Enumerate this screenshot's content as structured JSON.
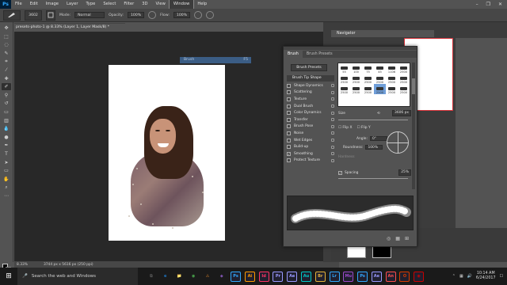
{
  "app": {
    "logo": "Ps",
    "menu": [
      "File",
      "Edit",
      "Image",
      "Layer",
      "Type",
      "Select",
      "Filter",
      "3D",
      "View",
      "Window",
      "Help"
    ],
    "active_menu": "Window",
    "window_controls": [
      "–",
      "❐",
      "✕"
    ]
  },
  "options_bar": {
    "brush_size": "3602",
    "mode_label": "Mode:",
    "mode_value": "Normal",
    "opacity_label": "Opacity:",
    "opacity_value": "100%",
    "flow_label": "Flow:",
    "flow_value": "100%"
  },
  "document": {
    "tab_title": "presets-photo-1 @ 8.33% (Layer 1, Layer Mask/8) *",
    "zoom": "8.33%",
    "doc_info": "3744 px x 5616 px (250 ppi)"
  },
  "brush_ghost": {
    "title": "Brush",
    "badge": "F5"
  },
  "navigator": {
    "title": "Navigator"
  },
  "brush_panel": {
    "tabs": [
      "Brush",
      "Brush Presets"
    ],
    "presets_button": "Brush Presets",
    "options_header": "Brush Tip Shape",
    "options": [
      {
        "label": "Shape Dynamics",
        "checked": false
      },
      {
        "label": "Scattering",
        "checked": false
      },
      {
        "label": "Texture",
        "checked": false
      },
      {
        "label": "Dual Brush",
        "checked": false
      },
      {
        "label": "Color Dynamics",
        "checked": false
      },
      {
        "label": "Transfer",
        "checked": false
      },
      {
        "label": "Brush Pose",
        "checked": false
      },
      {
        "label": "Noise",
        "checked": false
      },
      {
        "label": "Wet Edges",
        "checked": false
      },
      {
        "label": "Build-up",
        "checked": false
      },
      {
        "label": "Smoothing",
        "checked": true
      },
      {
        "label": "Protect Texture",
        "checked": false
      }
    ],
    "tip_sizes": [
      "55",
      "100",
      "75",
      "45",
      "1106",
      "2500",
      "2500",
      "2500",
      "2500",
      "2500",
      "2500",
      "2500",
      "2500",
      "2500",
      "2500",
      "2500",
      "2500",
      "2500"
    ],
    "selected_tip_index": 15,
    "size_label": "Size",
    "size_value": "3606 px",
    "flip_x": "Flip X",
    "flip_y": "Flip Y",
    "angle_label": "Angle:",
    "angle_value": "0°",
    "roundness_label": "Roundness:",
    "roundness_value": "100%",
    "hardness_label": "Hardness",
    "spacing_label": "Spacing",
    "spacing_checked": true,
    "spacing_value": "25%"
  },
  "taskbar": {
    "search_placeholder": "Search the web and Windows",
    "apps": [
      "⧉",
      "e",
      "📁",
      "◉",
      "⚠",
      "◆",
      "Ps",
      "Ai",
      "Id",
      "Pr",
      "Ae",
      "Au",
      "Br",
      "Lr",
      "Mu",
      "Ps",
      "Ae",
      "An",
      "O",
      "◉"
    ],
    "time": "10:14 AM",
    "date": "6/24/2017"
  }
}
